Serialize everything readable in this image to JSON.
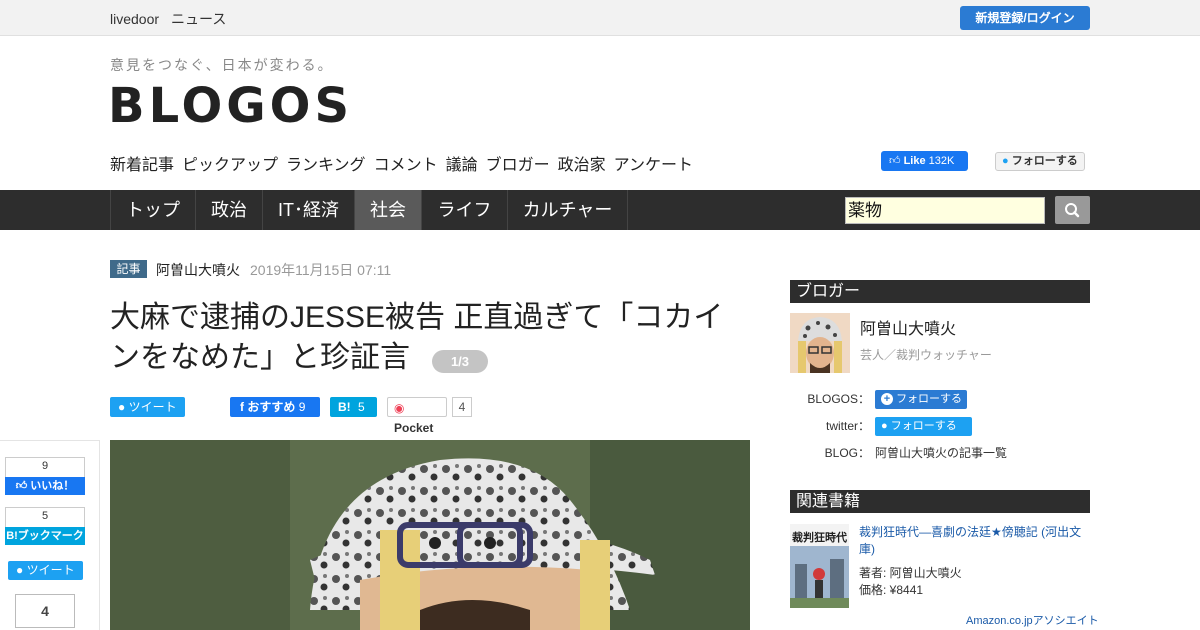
{
  "topbar": {
    "brand_1": "livedoor",
    "brand_2": "ニュース",
    "login_label": "新規登録/ログイン"
  },
  "header": {
    "tagline": "意見をつなぐ、日本が変わる。",
    "logo": "BLOGOS",
    "subnav": [
      "新着記事",
      "ピックアップ",
      "ランキング",
      "コメント",
      "議論",
      "ブロガー",
      "政治家",
      "アンケート"
    ],
    "fb_like_label": "Like",
    "fb_like_count": "132K",
    "twitter_follow_label": "フォローする"
  },
  "mainnav": {
    "tabs": [
      "トップ",
      "政治",
      "IT･経済",
      "社会",
      "ライフ",
      "カルチャー"
    ],
    "active_tab": "社会",
    "search_value": "薬物"
  },
  "article": {
    "badge": "記事",
    "author": "阿曽山大噴火",
    "date": "2019年11月15日 07:11",
    "headline": "大麻で逮捕のJESSE被告 正直過ぎて「コカインをなめた」と珍証言",
    "page_indicator": "1/3",
    "share": {
      "tweet_label": "ツイート",
      "fb_label": "おすすめ",
      "fb_count": "9",
      "hatena_label": "B!",
      "hatena_count": "5",
      "pocket_label": "Pocket",
      "pocket_count": "4"
    }
  },
  "floatbar": {
    "like_count": "9",
    "like_label": "いいね！",
    "hatena_count": "5",
    "hatena_label": "B!ブックマーク",
    "tweet_label": "ツイート",
    "pocket_count": "4"
  },
  "sidebar": {
    "blogger_heading": "ブロガー",
    "blogger_name": "阿曽山大噴火",
    "blogger_desc": "芸人／裁判ウォッチャー",
    "blogos_label": "BLOGOS：",
    "blogos_follow": "フォローする",
    "twitter_label": "twitter：",
    "twitter_follow": "フォローする",
    "blog_label": "BLOG：",
    "blog_link": "阿曽山大噴火の記事一覧",
    "books_heading": "関連書籍",
    "book_title": "裁判狂時代―喜劇の法廷★傍聴記 (河出文庫)",
    "book_author": "著者: 阿曽山大噴火",
    "book_price": "価格: ¥8441",
    "amazon_label": "Amazon.co.jpアソシエイト"
  },
  "colors": {
    "nav_bg": "#2d2d2d",
    "login_blue": "#2b7bd3",
    "twitter_blue": "#1da1f2",
    "facebook_blue": "#1877f2",
    "hatena_blue": "#00a4de",
    "article_badge": "#3f6a8a"
  }
}
